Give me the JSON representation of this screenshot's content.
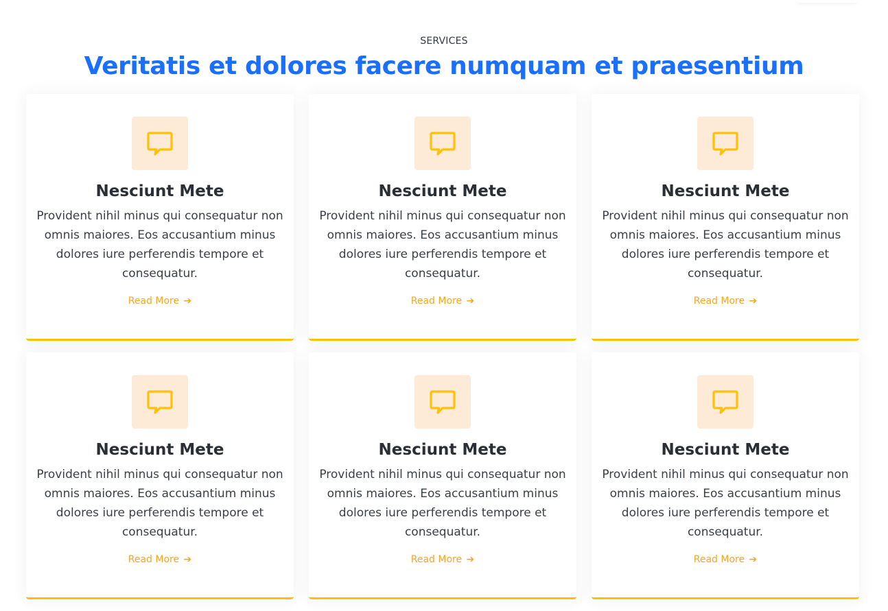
{
  "section": {
    "eyebrow": "SERVICES",
    "headline": "Veritatis et dolores facere numquam et praesentium"
  },
  "colors": {
    "accent": "#ffc107",
    "headline": "#1a6fff",
    "icon_bg": "#fdebd8",
    "link": "#f5a623"
  },
  "cards": [
    {
      "icon": "chat-bubble-icon",
      "title": "Nesciunt Mete",
      "description": "Provident nihil minus qui consequatur non omnis maiores. Eos accusantium minus dolores iure perferendis tempore et consequatur.",
      "link_label": "Read More",
      "link_arrow": "➔"
    },
    {
      "icon": "chat-bubble-icon",
      "title": "Nesciunt Mete",
      "description": "Provident nihil minus qui consequatur non omnis maiores. Eos accusantium minus dolores iure perferendis tempore et consequatur.",
      "link_label": "Read More",
      "link_arrow": "➔"
    },
    {
      "icon": "chat-bubble-icon",
      "title": "Nesciunt Mete",
      "description": "Provident nihil minus qui consequatur non omnis maiores. Eos accusantium minus dolores iure perferendis tempore et consequatur.",
      "link_label": "Read More",
      "link_arrow": "➔"
    },
    {
      "icon": "chat-bubble-icon",
      "title": "Nesciunt Mete",
      "description": "Provident nihil minus qui consequatur non omnis maiores. Eos accusantium minus dolores iure perferendis tempore et consequatur.",
      "link_label": "Read More",
      "link_arrow": "➔"
    },
    {
      "icon": "chat-bubble-icon",
      "title": "Nesciunt Mete",
      "description": "Provident nihil minus qui consequatur non omnis maiores. Eos accusantium minus dolores iure perferendis tempore et consequatur.",
      "link_label": "Read More",
      "link_arrow": "➔"
    },
    {
      "icon": "chat-bubble-icon",
      "title": "Nesciunt Mete",
      "description": "Provident nihil minus qui consequatur non omnis maiores. Eos accusantium minus dolores iure perferendis tempore et consequatur.",
      "link_label": "Read More",
      "link_arrow": "➔"
    }
  ]
}
